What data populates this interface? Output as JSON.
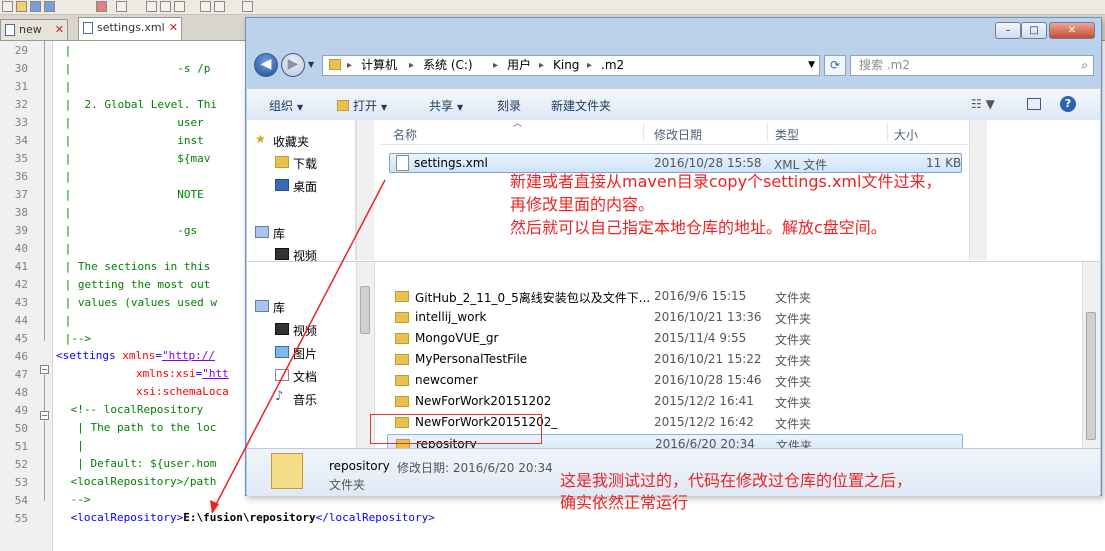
{
  "editor": {
    "tabs": [
      {
        "label": "new"
      },
      {
        "label": "settings.xml"
      }
    ],
    "line_numbers": [
      "29",
      "30",
      "31",
      "32",
      "33",
      "34",
      "35",
      "36",
      "37",
      "38",
      "39",
      "40",
      "41",
      "42",
      "43",
      "44",
      "45",
      "46",
      "47",
      "48",
      "49",
      "50",
      "51",
      "52",
      "53",
      "54",
      "55"
    ],
    "lines": [
      " |",
      " |                -s /p",
      " |",
      " |  2. Global Level. Thi",
      " |                user",
      " |                inst",
      " |                ${mav",
      " |",
      " |                NOTE",
      " |",
      " |                -gs",
      " |",
      " | The sections in this",
      " | getting the most out",
      " | values (values used w",
      " |",
      " |-->"
    ],
    "line46": {
      "tag_open": "<settings ",
      "attr": "xmlns",
      "eq": "=",
      "val": "\"http://"
    },
    "line47": {
      "attr": "xmlns:xsi",
      "eq": "=",
      "val": "\"htt"
    },
    "line48": {
      "attr": "xsi:schemaLoca"
    },
    "line49": " <!-- localRepository",
    "line50": "  | The path to the loc",
    "line51": "  |",
    "line52": "  | Default: ${user.hom",
    "line53": " <localRepository>/path",
    "line54": " -->",
    "line55": {
      "open": " <localRepository>",
      "value": "E:\\fusion\\repository",
      "close": "</localRepository>"
    }
  },
  "explorer": {
    "window_controls": {
      "min": "–",
      "max": "□",
      "close": "✕"
    },
    "breadcrumbs": [
      "计算机",
      "系统 (C:)",
      "用户",
      "King",
      ".m2"
    ],
    "search_placeholder": "搜索 .m2",
    "commands": {
      "organize": "组织",
      "open": "打开",
      "share": "共享",
      "burn": "刻录",
      "new_folder": "新建文件夹"
    },
    "nav_top": [
      {
        "label": "收藏夹"
      },
      {
        "label": "下载"
      },
      {
        "label": "桌面"
      },
      {
        "label": "库"
      },
      {
        "label": "视频"
      }
    ],
    "columns": {
      "name": "名称",
      "date": "修改日期",
      "type": "类型",
      "size": "大小"
    },
    "file": {
      "name": "settings.xml",
      "date": "2016/10/28 15:58",
      "type": "XML 文件",
      "size": "11 KB"
    },
    "nav_bottom": [
      {
        "label": "库"
      },
      {
        "label": "视频"
      },
      {
        "label": "图片"
      },
      {
        "label": "文档"
      },
      {
        "label": "音乐"
      }
    ],
    "folders": [
      {
        "name": "GitHub_2_11_0_5离线安装包以及文件下...",
        "date": "2016/9/6 15:15",
        "type": "文件夹"
      },
      {
        "name": "intellij_work",
        "date": "2016/10/21 13:36",
        "type": "文件夹"
      },
      {
        "name": "MongoVUE_gr",
        "date": "2015/11/4 9:55",
        "type": "文件夹"
      },
      {
        "name": "MyPersonalTestFile",
        "date": "2016/10/21 15:22",
        "type": "文件夹"
      },
      {
        "name": "newcomer",
        "date": "2016/10/28 15:46",
        "type": "文件夹"
      },
      {
        "name": "NewForWork20151202",
        "date": "2015/12/2 16:41",
        "type": "文件夹"
      },
      {
        "name": "NewForWork20151202_",
        "date": "2015/12/2 16:42",
        "type": "文件夹"
      },
      {
        "name": "repository",
        "date": "2016/6/20 20:34",
        "type": "文件夹"
      }
    ],
    "details": {
      "name": "repository",
      "modified_label": "修改日期: 2016/6/20 20:34",
      "kind": "文件夹"
    }
  },
  "annotations": {
    "top": [
      "新建或者直接从maven目录copy个settings.xml文件过来，",
      "再修改里面的内容。",
      "然后就可以自己指定本地仓库的地址。解放c盘空间。"
    ],
    "bottom": [
      "这是我测试过的，代码在修改过仓库的位置之后，",
      "确实依然正常运行"
    ],
    "color": "#ee2222"
  }
}
